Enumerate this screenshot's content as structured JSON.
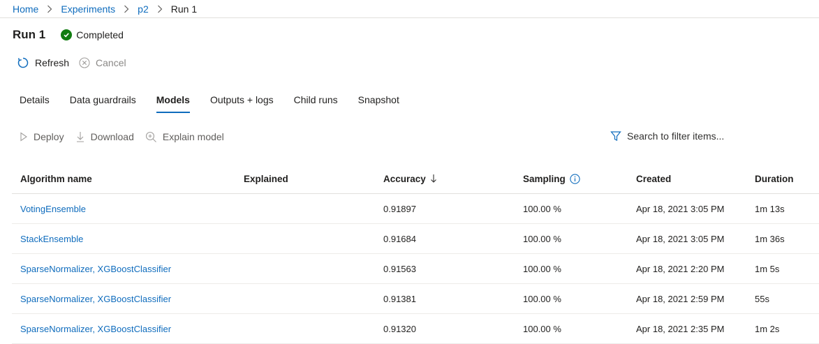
{
  "breadcrumb": {
    "items": [
      "Home",
      "Experiments",
      "p2"
    ],
    "current": "Run 1"
  },
  "header": {
    "title": "Run 1",
    "status": "Completed"
  },
  "commands": {
    "refresh": "Refresh",
    "cancel": "Cancel"
  },
  "tabs": [
    "Details",
    "Data guardrails",
    "Models",
    "Outputs + logs",
    "Child runs",
    "Snapshot"
  ],
  "active_tab": "Models",
  "toolbar": {
    "deploy": "Deploy",
    "download": "Download",
    "explain": "Explain model",
    "filter_placeholder": "Search to filter items..."
  },
  "table": {
    "columns": {
      "algorithm": "Algorithm name",
      "explained": "Explained",
      "accuracy": "Accuracy",
      "sampling": "Sampling",
      "created": "Created",
      "duration": "Duration"
    },
    "rows": [
      {
        "algorithm": "VotingEnsemble",
        "explained": "",
        "accuracy": "0.91897",
        "sampling": "100.00 %",
        "created": "Apr 18, 2021 3:05 PM",
        "duration": "1m 13s"
      },
      {
        "algorithm": "StackEnsemble",
        "explained": "",
        "accuracy": "0.91684",
        "sampling": "100.00 %",
        "created": "Apr 18, 2021 3:05 PM",
        "duration": "1m 36s"
      },
      {
        "algorithm": "SparseNormalizer, XGBoostClassifier",
        "explained": "",
        "accuracy": "0.91563",
        "sampling": "100.00 %",
        "created": "Apr 18, 2021 2:20 PM",
        "duration": "1m 5s"
      },
      {
        "algorithm": "SparseNormalizer, XGBoostClassifier",
        "explained": "",
        "accuracy": "0.91381",
        "sampling": "100.00 %",
        "created": "Apr 18, 2021 2:59 PM",
        "duration": "55s"
      },
      {
        "algorithm": "SparseNormalizer, XGBoostClassifier",
        "explained": "",
        "accuracy": "0.91320",
        "sampling": "100.00 %",
        "created": "Apr 18, 2021 2:35 PM",
        "duration": "1m 2s"
      }
    ]
  },
  "colors": {
    "link": "#0f6cbd",
    "success": "#107c10",
    "disabled": "#8a8886"
  }
}
